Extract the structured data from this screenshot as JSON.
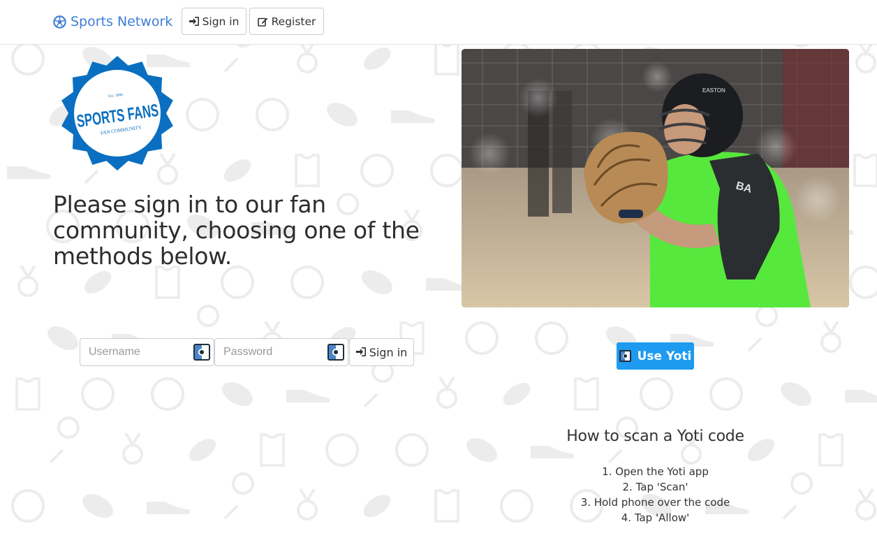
{
  "navbar": {
    "brand": "Sports Network",
    "brand_icon": "soccer-ball-icon",
    "signin_label": "Sign in",
    "register_label": "Register",
    "brand_color": "#3d7dd8"
  },
  "logo": {
    "established": "Est. 1986",
    "name": "SPORTS FANS",
    "subtitle": "FAN COMMUNITY",
    "color": "#0a6fc0"
  },
  "main": {
    "headline": "Please sign in to our fan community, choosing one of the methods below."
  },
  "form": {
    "username_placeholder": "Username",
    "password_placeholder": "Password",
    "signin_label": "Sign in"
  },
  "yoti": {
    "button_label": "Use Yoti",
    "button_color": "#1e9bf0",
    "howto_title": "How to scan a Yoti code",
    "steps": [
      "1. Open the Yoti app",
      "2. Tap 'Scan'",
      "3. Hold phone over the code",
      "4. Tap 'Allow'"
    ]
  },
  "photo": {
    "helmet_text": "EASTON"
  }
}
